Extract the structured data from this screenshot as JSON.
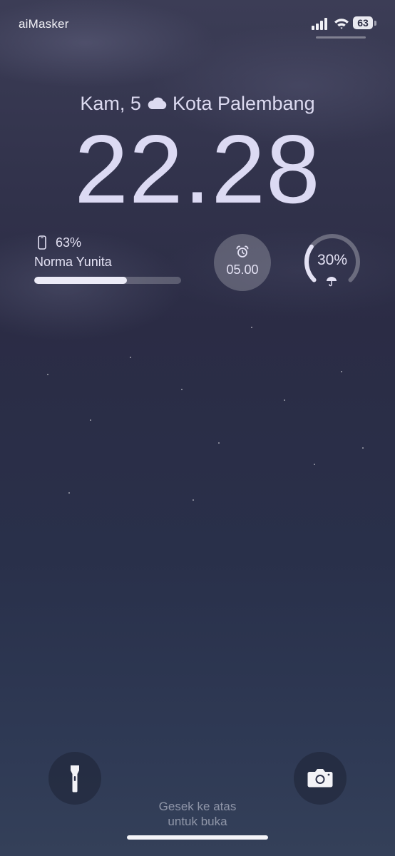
{
  "status_bar": {
    "carrier": "aiMasker",
    "battery_level": "63",
    "icons": [
      "cellular-signal-icon",
      "wifi-icon",
      "battery-icon"
    ]
  },
  "lock_screen": {
    "date": "Kam, 5",
    "weather_icon": "cloud-icon",
    "location": "Kota Palembang",
    "time": "22.28"
  },
  "widgets": {
    "battery": {
      "icon": "phone-icon",
      "percent_label": "63%",
      "level": 0.63,
      "device_name": "Norma Yunita"
    },
    "alarm": {
      "icon": "alarm-clock-icon",
      "time": "05.00"
    },
    "rain_chance": {
      "percent_label": "30%",
      "level": 0.3,
      "icon": "umbrella-icon"
    }
  },
  "bottom": {
    "left_button_icon": "flashlight-icon",
    "right_button_icon": "camera-icon",
    "hint_line1": "Gesek ke atas",
    "hint_line2": "untuk buka"
  },
  "colors": {
    "text_primary": "#dcdaf3",
    "background_top": "#3c3d56",
    "background_bottom": "#344059"
  }
}
